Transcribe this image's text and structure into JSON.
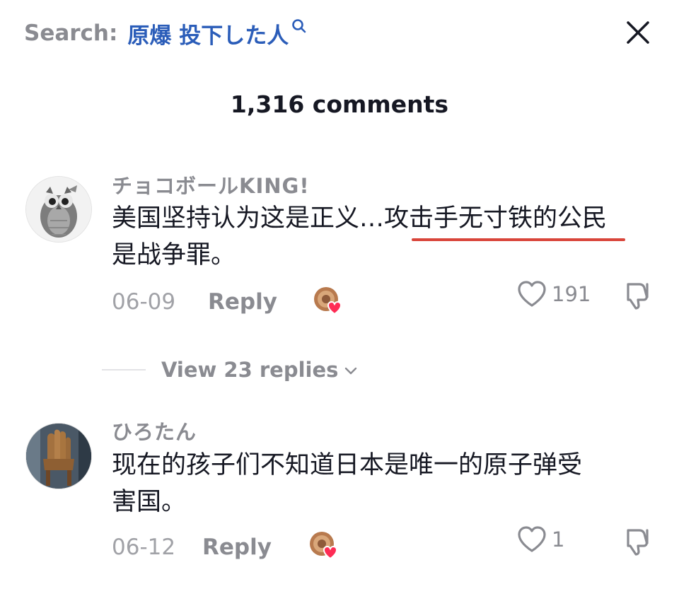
{
  "search": {
    "prefix": "Search:",
    "term": "原爆 投下した人"
  },
  "header": {
    "comment_count": "1,316 comments"
  },
  "comments": [
    {
      "username": "チョコボールKING!",
      "text_line1": "美国坚持认为这是正义…",
      "text_highlight": "攻击手无寸铁的公民",
      "text_line2": "是战争罪。",
      "date": "06-09",
      "reply_label": "Reply",
      "likes": "191"
    },
    {
      "username": "ひろたん",
      "text_line1": "现在的孩子们不知道日本是唯一的原子弹受",
      "text_line2": "害国。",
      "date": "06-12",
      "reply_label": "Reply",
      "likes": "1"
    }
  ],
  "view_replies": {
    "label": "View 23 replies"
  },
  "colors": {
    "search_term": "#2b5db9",
    "muted": "#8a8b91",
    "underline": "#d9453a",
    "heart_badge": "#fe2c55"
  }
}
